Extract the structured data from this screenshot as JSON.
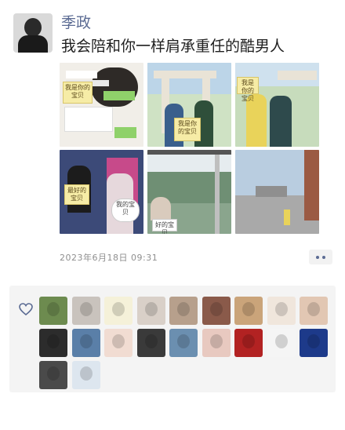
{
  "post": {
    "user_name": "季政",
    "text": "我会陪和你一样肩承重任的酷男人",
    "photo_signs": {
      "p1_sign": "我是你的宝贝",
      "p2_sign": "我是你的宝贝",
      "p3_sign": "我是你的宝贝",
      "p4_sign": "最好的宝贝",
      "p5_sign": "我的宝贝",
      "p6_sign": "好的宝贝"
    },
    "timestamp": "2023年6月18日 09:31",
    "more_icon": "ellipsis-icon"
  },
  "likes": {
    "icon": "heart-outline-icon",
    "count_shown": 20,
    "colors": [
      "#6d8b4f",
      "#c9c3bd",
      "#f5f1d9",
      "#d9d0c8",
      "#b7a08c",
      "#8a5a4a",
      "#caa47a",
      "#f0e6dc",
      "#e2c7b3",
      "#2c2c2c",
      "#5a7fa8",
      "#f1dcd2",
      "#3a3a3a",
      "#6b8fb0",
      "#e8c9c0",
      "#b22222",
      "#f5f5f5",
      "#1d3a8a",
      "#4a4a4a",
      "#dde6ef"
    ]
  }
}
